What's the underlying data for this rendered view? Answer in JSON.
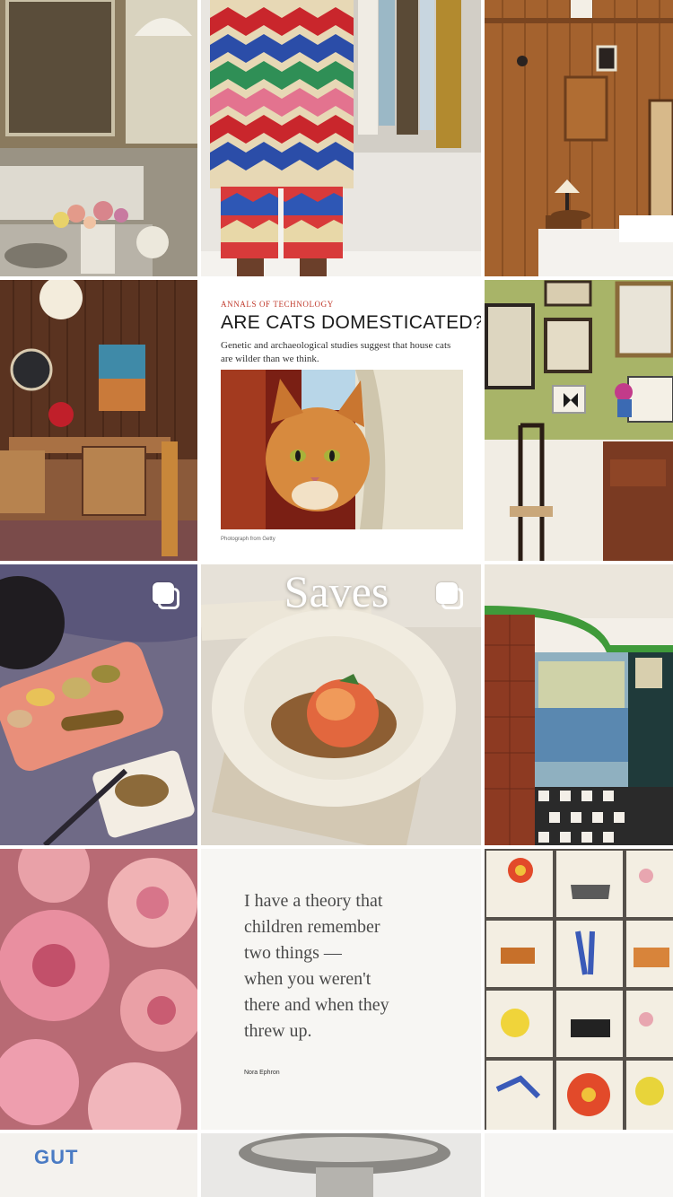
{
  "header": {
    "title": "Saves"
  },
  "posts": {
    "closet_portrait": {
      "description": "kitchen-sink-flowers"
    },
    "article": {
      "kicker": "ANNALS OF TECHNOLOGY",
      "headline": "ARE CATS DOMESTICATED?",
      "dek": "Genetic and archaeological studies suggest that house cats are wilder than we think.",
      "photo_credit": "Photograph from Getty"
    },
    "quote": {
      "text": "I have a theory that\nchildren remember\ntwo things —\nwhen you weren't\nthere and when they\nthrew up.",
      "author": "Nora Ephron"
    },
    "partial_logo": {
      "text": "GUT"
    }
  },
  "icons": {
    "carousel": "multiple-posts-icon"
  },
  "colors": {
    "accent_red": "#c0392b",
    "gut_blue": "#4a7bc4"
  }
}
